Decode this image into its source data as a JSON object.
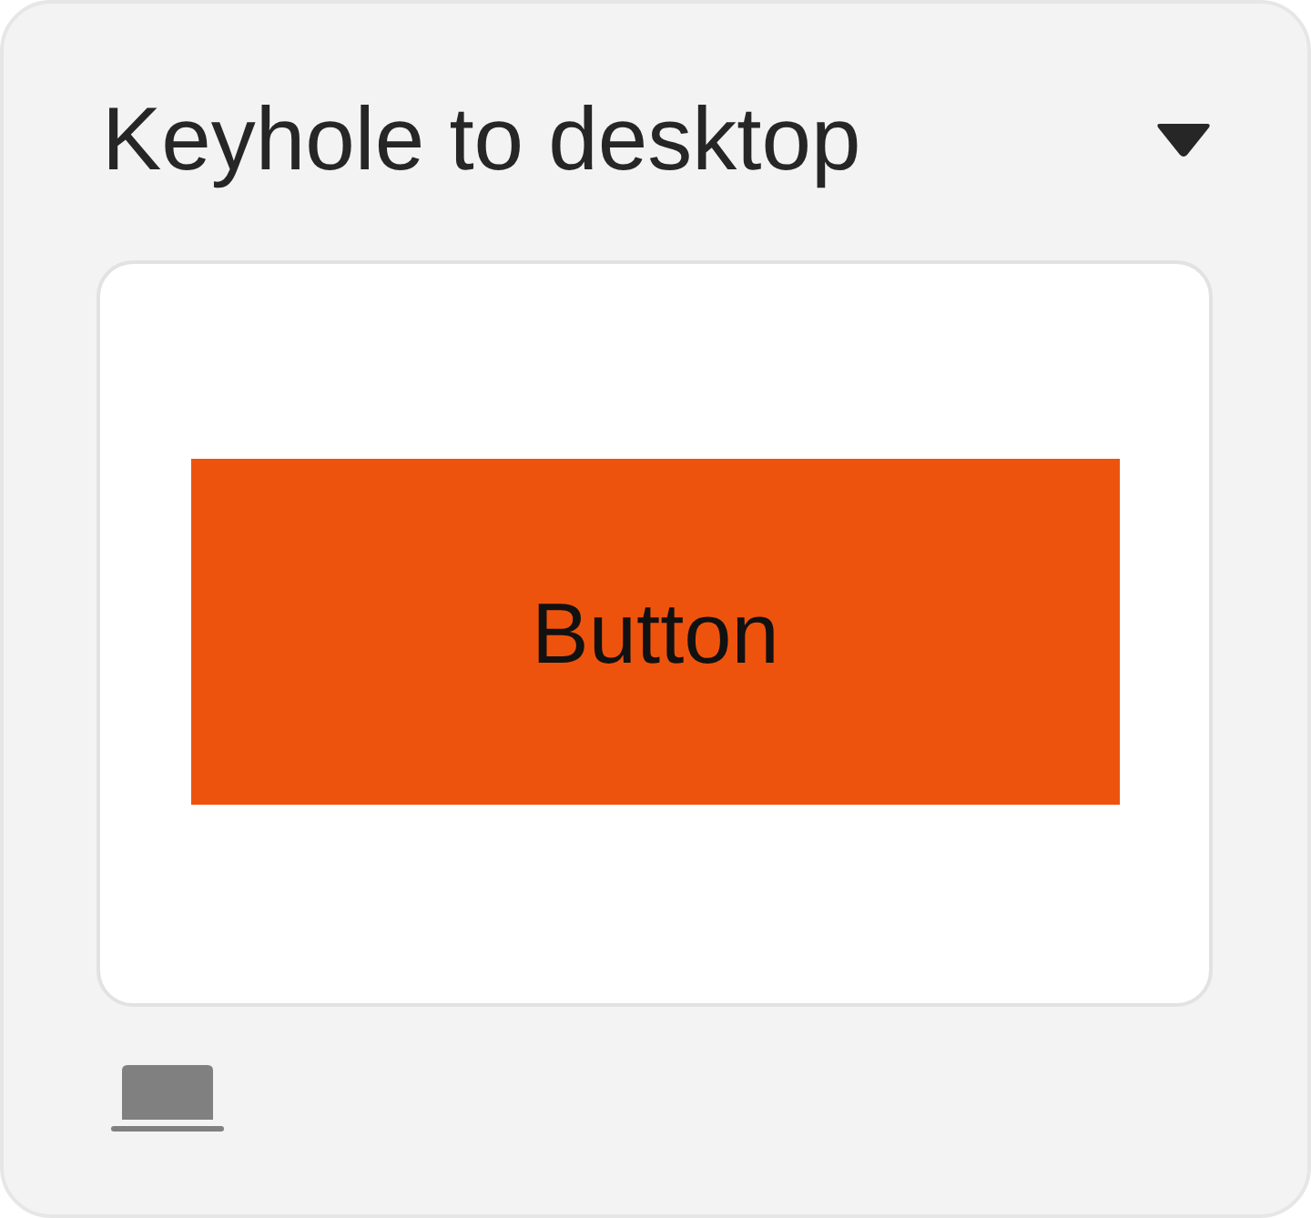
{
  "card": {
    "title": "Keyhole to desktop",
    "expanded": false
  },
  "preview": {
    "button": {
      "label": "Button"
    }
  }
}
